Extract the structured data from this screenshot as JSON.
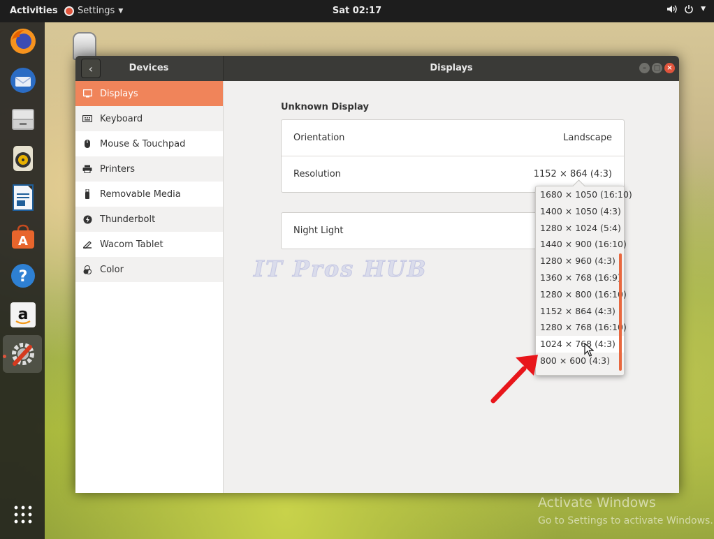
{
  "topbar": {
    "activities": "Activities",
    "app_menu": "Settings",
    "clock": "Sat 02:17",
    "volume_icon": "volume-icon",
    "power_icon": "power-icon"
  },
  "dock": {
    "items": [
      "firefox-icon",
      "thunderbird-icon",
      "files-icon",
      "rhythmbox-icon",
      "writer-icon",
      "software-icon",
      "help-icon",
      "amazon-icon",
      "settings-icon"
    ],
    "show_apps_icon": "show-applications-icon"
  },
  "window": {
    "sidebar_title": "Devices",
    "main_title": "Displays"
  },
  "sidebar": {
    "items": [
      {
        "label": "Displays",
        "icon": "display-icon",
        "selected": true
      },
      {
        "label": "Keyboard",
        "icon": "keyboard-icon"
      },
      {
        "label": "Mouse & Touchpad",
        "icon": "mouse-icon"
      },
      {
        "label": "Printers",
        "icon": "printer-icon"
      },
      {
        "label": "Removable Media",
        "icon": "usb-icon"
      },
      {
        "label": "Thunderbolt",
        "icon": "thunderbolt-icon"
      },
      {
        "label": "Wacom Tablet",
        "icon": "tablet-icon"
      },
      {
        "label": "Color",
        "icon": "color-icon"
      }
    ]
  },
  "display": {
    "name": "Unknown Display",
    "orientation_label": "Orientation",
    "orientation_value": "Landscape",
    "resolution_label": "Resolution",
    "resolution_value": "1152 × 864 (4:3)",
    "night_light_label": "Night Light"
  },
  "resolution_dropdown": {
    "options": [
      "1680 × 1050 (16:10)",
      "1400 × 1050 (4:3)",
      "1280 × 1024 (5:4)",
      "1440 × 900 (16:10)",
      "1280 × 960 (4:3)",
      "1360 × 768 (16:9)",
      "1280 × 800 (16:10)",
      "1152 × 864 (4:3)",
      "1280 × 768 (16:10)",
      "1024 × 768 (4:3)",
      "800 × 600 (4:3)"
    ],
    "hovered_index": 9
  },
  "overlay": {
    "watermark": "IT Pros HUB",
    "arrow_color": "#e8161b",
    "activate_title": "Activate Windows",
    "activate_sub": "Go to Settings to activate Windows."
  },
  "colors": {
    "accent": "#f0845a",
    "close_button": "#e0543c",
    "titlebar": "#3a3a37"
  }
}
